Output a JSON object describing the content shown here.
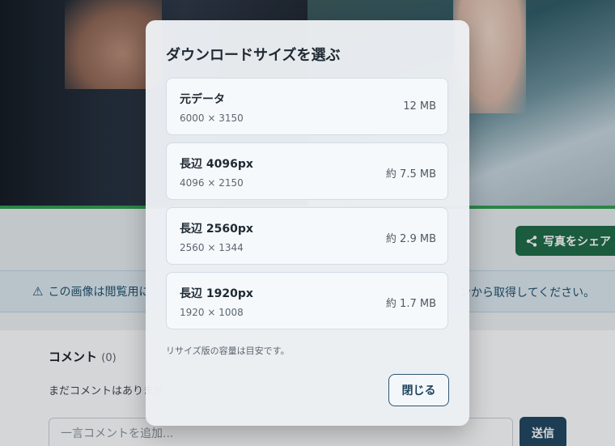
{
  "page": {
    "share_label": "写真をシェア",
    "notice_warn_icon": "warning-icon",
    "notice_text_a": "この画像は閲覧用に",
    "notice_text_b": "ンから取得してください。",
    "comments_title": "コメント",
    "comments_count": "(0)",
    "no_comments": "まだコメントはありませ",
    "comment_placeholder": "一言コメントを追加...",
    "send_label": "送信"
  },
  "modal": {
    "title": "ダウンロードサイズを選ぶ",
    "options": [
      {
        "label": "元データ",
        "dims": "6000 × 3150",
        "size": "12 MB"
      },
      {
        "label": "長辺 4096px",
        "dims": "4096 × 2150",
        "size": "約 7.5 MB"
      },
      {
        "label": "長辺 2560px",
        "dims": "2560 × 1344",
        "size": "約 2.9 MB"
      },
      {
        "label": "長辺 1920px",
        "dims": "1920 × 1008",
        "size": "約 1.7 MB"
      }
    ],
    "note": "リサイズ版の容量は目安です。",
    "close_label": "閉じる"
  },
  "colors": {
    "accent_green": "#1d6a45",
    "primary_navy": "#1f4560",
    "notice_bg": "#dde9f0"
  }
}
